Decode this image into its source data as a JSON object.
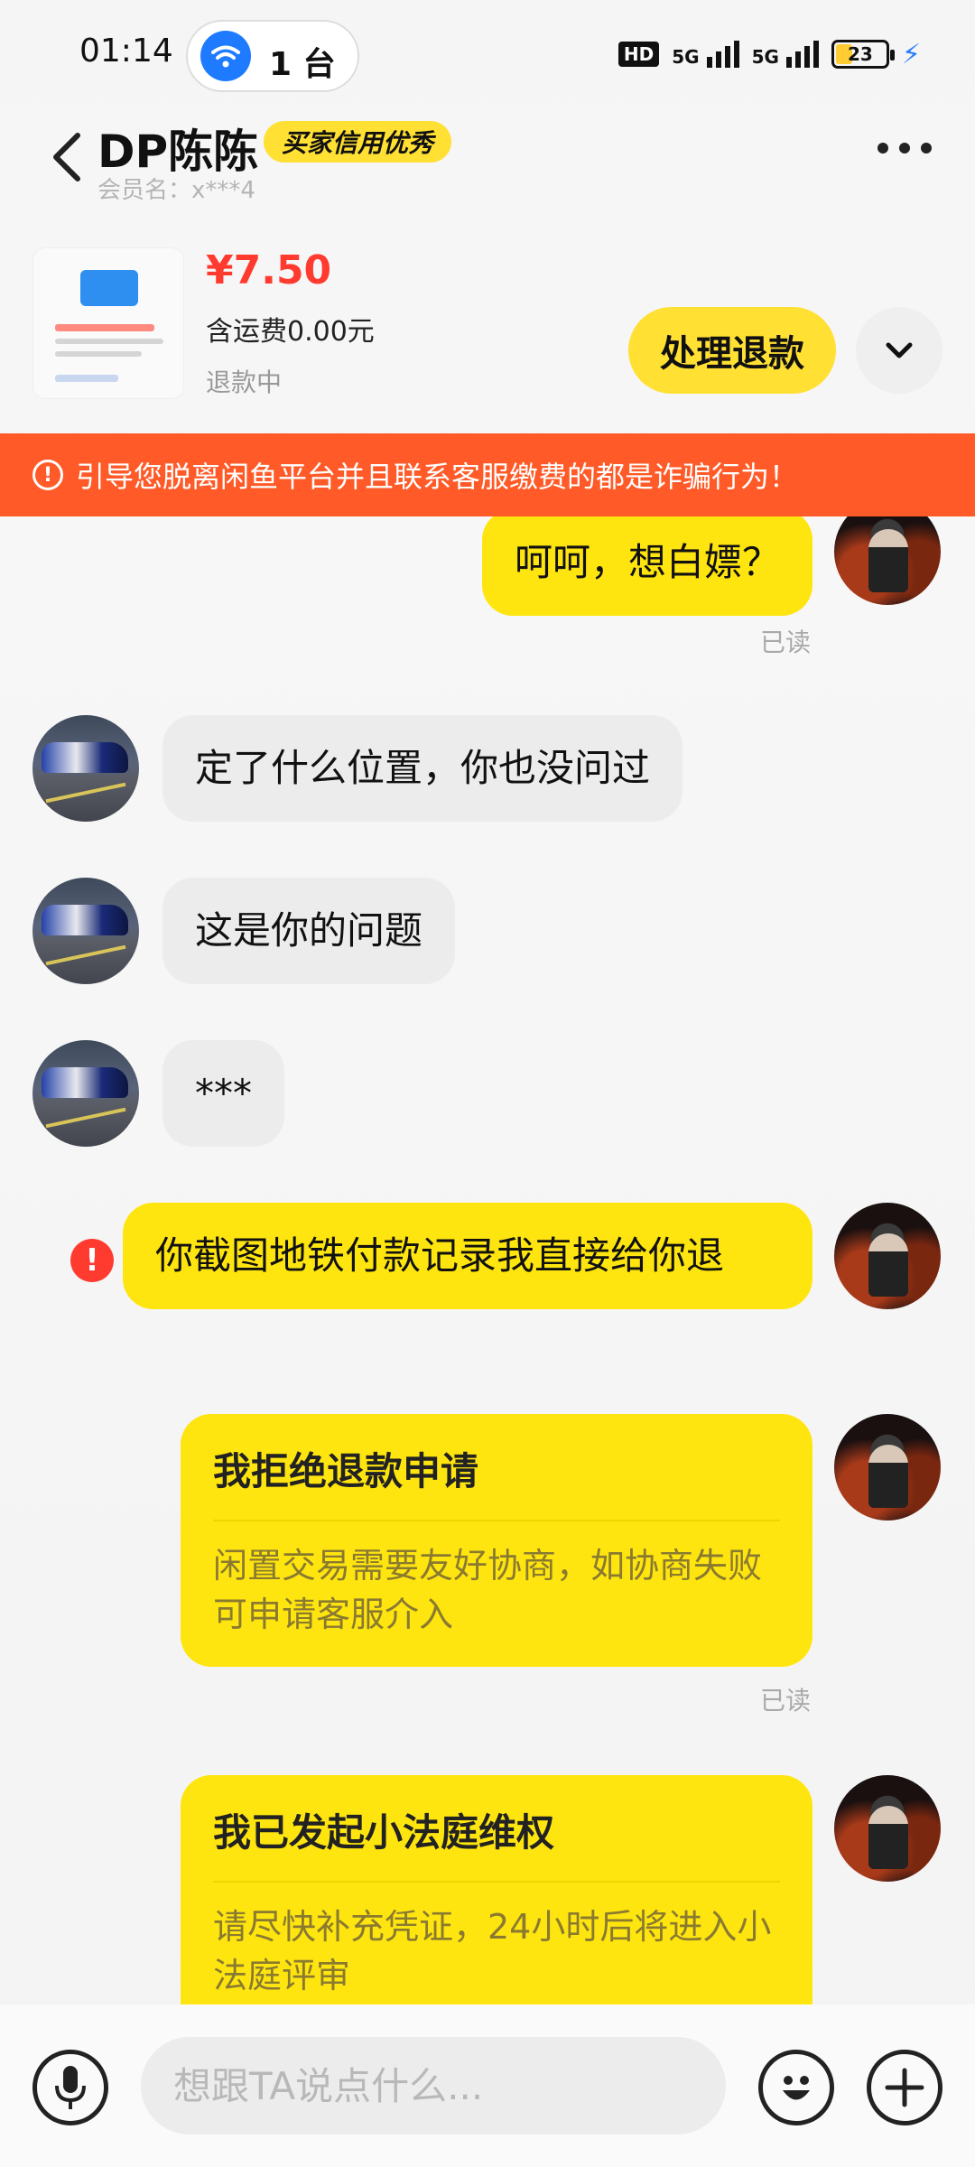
{
  "status_bar": {
    "time": "01:14",
    "hotspot_count": "1 台",
    "hd_label": "HD",
    "signal_1": "5G",
    "signal_2": "5G",
    "battery": "23"
  },
  "header": {
    "nickname": "DP陈陈",
    "credit_badge": "买家信用优秀",
    "member_label": "会员名：",
    "member_name": "x***4"
  },
  "order": {
    "price": "¥7.50",
    "shipping": "含运费0.00元",
    "status": "退款中",
    "refund_button": "处理退款"
  },
  "warning": "引导您脱离闲鱼平台并且联系客服缴费的都是诈骗行为！",
  "messages": [
    {
      "side": "me",
      "text": "呵呵，想白嫖？",
      "read": "已读"
    },
    {
      "side": "them",
      "text": "定了什么位置，你也没问过"
    },
    {
      "side": "them",
      "text": "这是你的问题"
    },
    {
      "side": "them",
      "text": "***"
    },
    {
      "side": "me",
      "text": "你截图地铁付款记录我直接给你退",
      "error": true
    },
    {
      "side": "me",
      "card": true,
      "title": "我拒绝退款申请",
      "body": "闲置交易需要友好协商，如协商失败可申请客服介入",
      "read": "已读"
    },
    {
      "side": "me",
      "card": true,
      "title": "我已发起小法庭维权",
      "body": "请尽快补充凭证，24小时后将进入小法庭评审"
    }
  ],
  "input": {
    "placeholder": "想跟TA说点什么..."
  },
  "colors": {
    "accent_yellow": "#ffe50f",
    "warning_orange": "#ff5a27",
    "price_red": "#ff3b30"
  }
}
